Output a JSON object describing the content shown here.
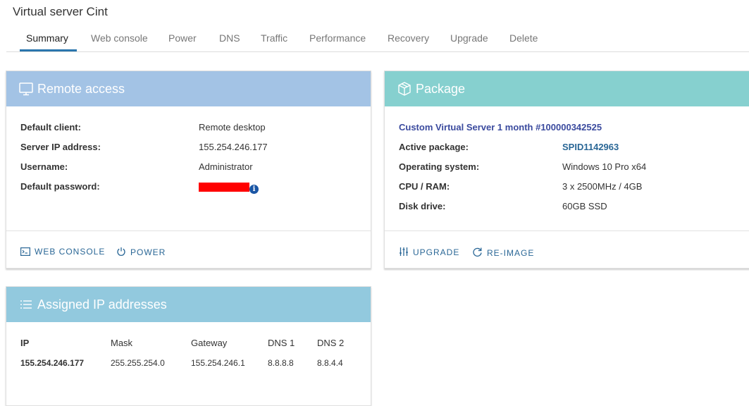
{
  "page_title": "Virtual server Cint",
  "tabs": [
    {
      "label": "Summary",
      "active": true
    },
    {
      "label": "Web console"
    },
    {
      "label": "Power"
    },
    {
      "label": "DNS"
    },
    {
      "label": "Traffic"
    },
    {
      "label": "Performance"
    },
    {
      "label": "Recovery"
    },
    {
      "label": "Upgrade"
    },
    {
      "label": "Delete"
    }
  ],
  "remote_access": {
    "title": "Remote access",
    "header_color": "#a3c3e5",
    "icon": "monitor-icon",
    "rows": [
      {
        "label": "Default client:",
        "value": "Remote desktop"
      },
      {
        "label": "Server IP address:",
        "value": "155.254.246.177"
      },
      {
        "label": "Username:",
        "value": "Administrator"
      },
      {
        "label": "Default password:",
        "value": ""
      }
    ],
    "actions": [
      {
        "label": "WEB CONSOLE",
        "icon": "console-icon"
      },
      {
        "label": "POWER",
        "icon": "power-icon"
      }
    ]
  },
  "package": {
    "title": "Package",
    "header_color": "#86d0cf",
    "icon": "box-icon",
    "name": "Custom Virtual Server 1 month #100000342525",
    "rows": [
      {
        "label": "Active package:",
        "value": "SPID1142963"
      },
      {
        "label": "Operating system:",
        "value": "Windows 10 Pro x64"
      },
      {
        "label": "CPU / RAM:",
        "value": "3 x 2500MHz / 4GB"
      },
      {
        "label": "Disk drive:",
        "value": "60GB SSD"
      }
    ],
    "actions": [
      {
        "label": "UPGRADE",
        "icon": "sliders-icon"
      },
      {
        "label": "RE-IMAGE",
        "icon": "refresh-icon"
      }
    ]
  },
  "ip_addresses": {
    "title": "Assigned IP addresses",
    "header_color": "#92c9de",
    "icon": "list-icon",
    "columns": [
      "IP",
      "Mask",
      "Gateway",
      "DNS 1",
      "DNS 2"
    ],
    "rows": [
      [
        "155.254.246.177",
        "255.255.254.0",
        "155.254.246.1",
        "8.8.8.8",
        "8.8.4.4"
      ]
    ]
  },
  "colors": {
    "accent": "#2a76ae",
    "link": "#2a6796",
    "redaction": "#ff0000"
  }
}
